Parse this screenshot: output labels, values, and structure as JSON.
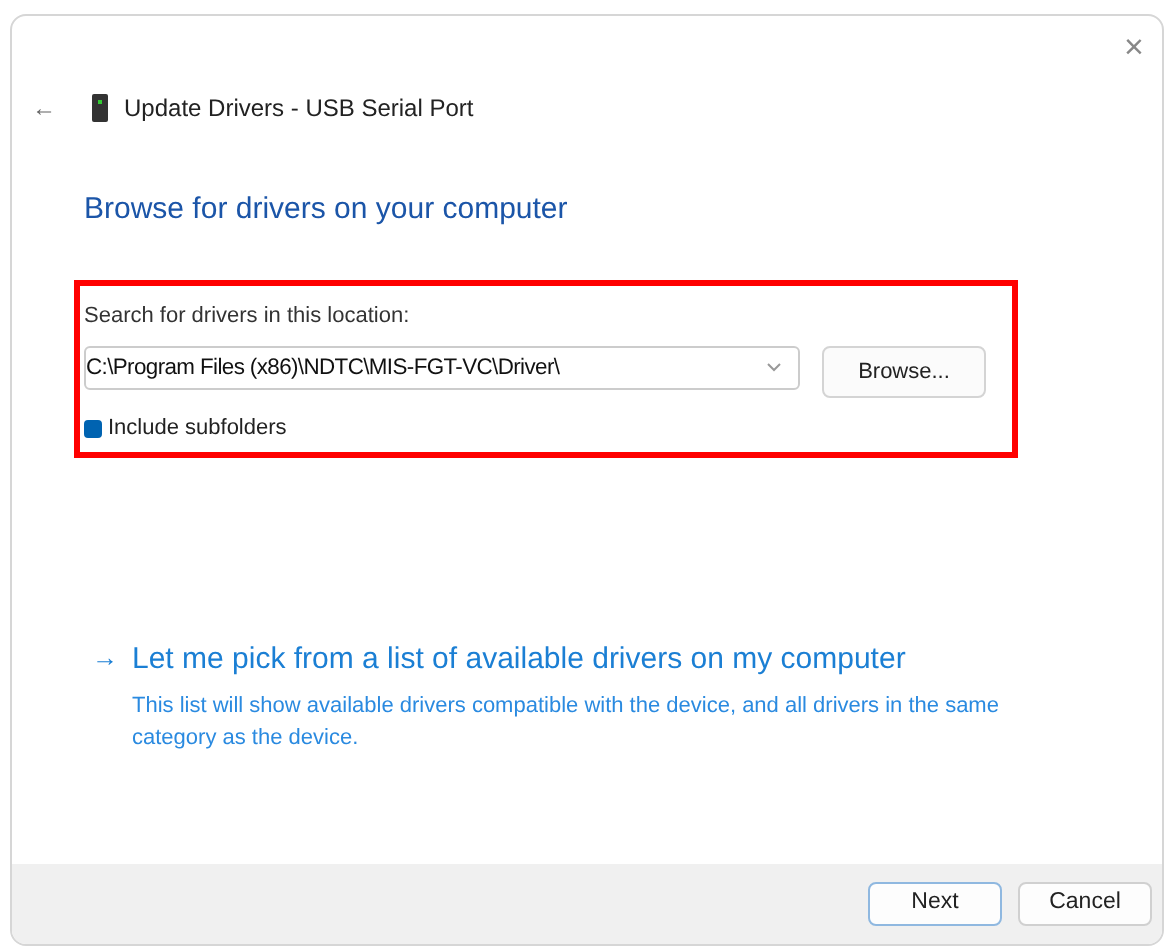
{
  "window": {
    "close": "×"
  },
  "header": {
    "back": "←",
    "title": "Update Drivers - USB Serial Port"
  },
  "heading": "Browse for drivers on your computer",
  "location": {
    "label": "Search for drivers in this location:",
    "value": "C:\\Program Files (x86)\\NDTC\\MIS-FGT-VC\\Driver\\",
    "browse": "Browse...",
    "include_subfolders": {
      "label": "Include subfolders",
      "checked": true
    }
  },
  "pick": {
    "arrow": "→",
    "title": "Let me pick from a list of available drivers on my computer",
    "description": "This list will show available drivers compatible with the device, and all drivers in the same category as the device."
  },
  "buttons": [
    {
      "label": "Next",
      "default": true
    },
    {
      "label": "Cancel",
      "default": false
    }
  ]
}
